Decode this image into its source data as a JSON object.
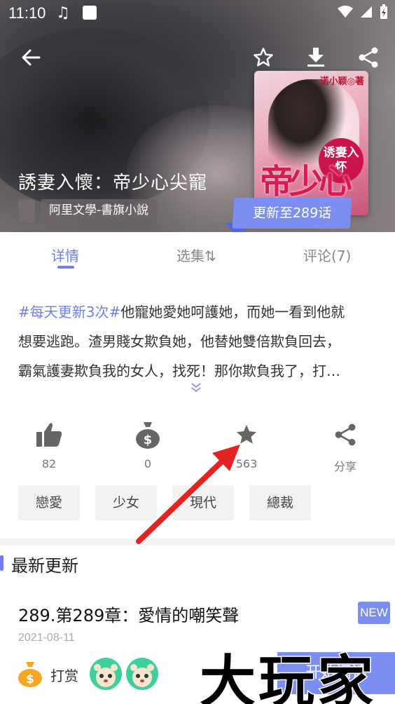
{
  "status_bar": {
    "time": "11:10"
  },
  "header": {
    "book_title": "誘妻入懷：帝少心尖寵",
    "source": "阿里文學-書旗小說",
    "update_tag": "更新至289话",
    "cover": {
      "author": "诺小颖◎著",
      "badge": "诱妻入怀",
      "title": "帝少心尖宠"
    }
  },
  "tabs": [
    {
      "label": "详情"
    },
    {
      "label": "选集⇅"
    },
    {
      "label": "评论(7)"
    }
  ],
  "description": {
    "hashtag": "#每天更新3次#",
    "line1_rest": "他寵她愛她呵護她，而她一看到他就",
    "line2": "想要逃跑。渣男賤女欺負她，他替她雙倍欺負回去，",
    "line3": "霸氣護妻欺負我的女人，找死！那你欺負我了，打…"
  },
  "stats": {
    "likes": "82",
    "rewards": "0",
    "favorites": "563",
    "share": "分享"
  },
  "tags": [
    "戀愛",
    "少女",
    "現代",
    "總裁"
  ],
  "latest": {
    "section_title": "最新更新",
    "chapter": "289.第289章：愛情的嘲笑聲",
    "badge": "NEW",
    "date": "2021-08-11"
  },
  "bottom": {
    "reward_label": "打赏",
    "start_label": "开始阅读"
  },
  "watermark": "大玩家",
  "colors": {
    "accent": "#7d8ef2",
    "arrow": "#e52222"
  }
}
